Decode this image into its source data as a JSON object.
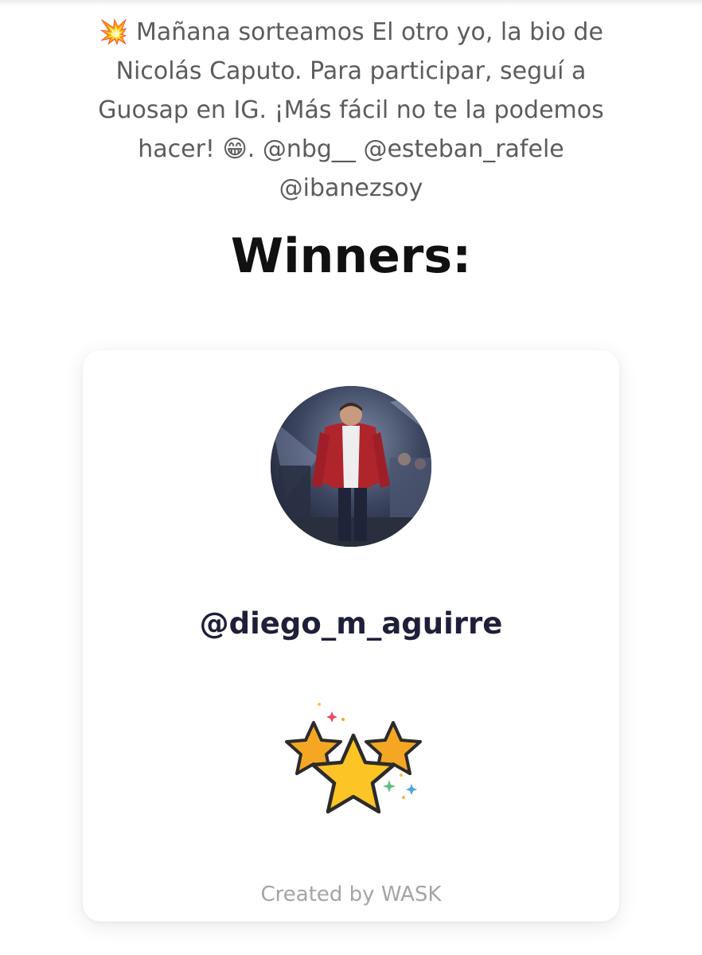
{
  "post": {
    "description": "💥 Mañana sorteamos El otro yo, la bio de Nicolás Caputo. Para participar, seguí a Guosap en IG. ¡Más fácil no te la podemos hacer! 😁. @nbg__ @esteban_rafele @ibanezsoy"
  },
  "results": {
    "title": "Winners:",
    "winner": {
      "username": "@diego_m_aguirre"
    },
    "footer": "Created by WASK"
  },
  "icons": {
    "avatar": "profile-photo",
    "celebration": "three-stars-icon"
  },
  "colors": {
    "title": "#111111",
    "username": "#1f1f3a",
    "description": "#5c5c5c",
    "footer": "#a4a4a4",
    "star_fill": "#fcc425",
    "star_small_fill": "#f5a623"
  }
}
